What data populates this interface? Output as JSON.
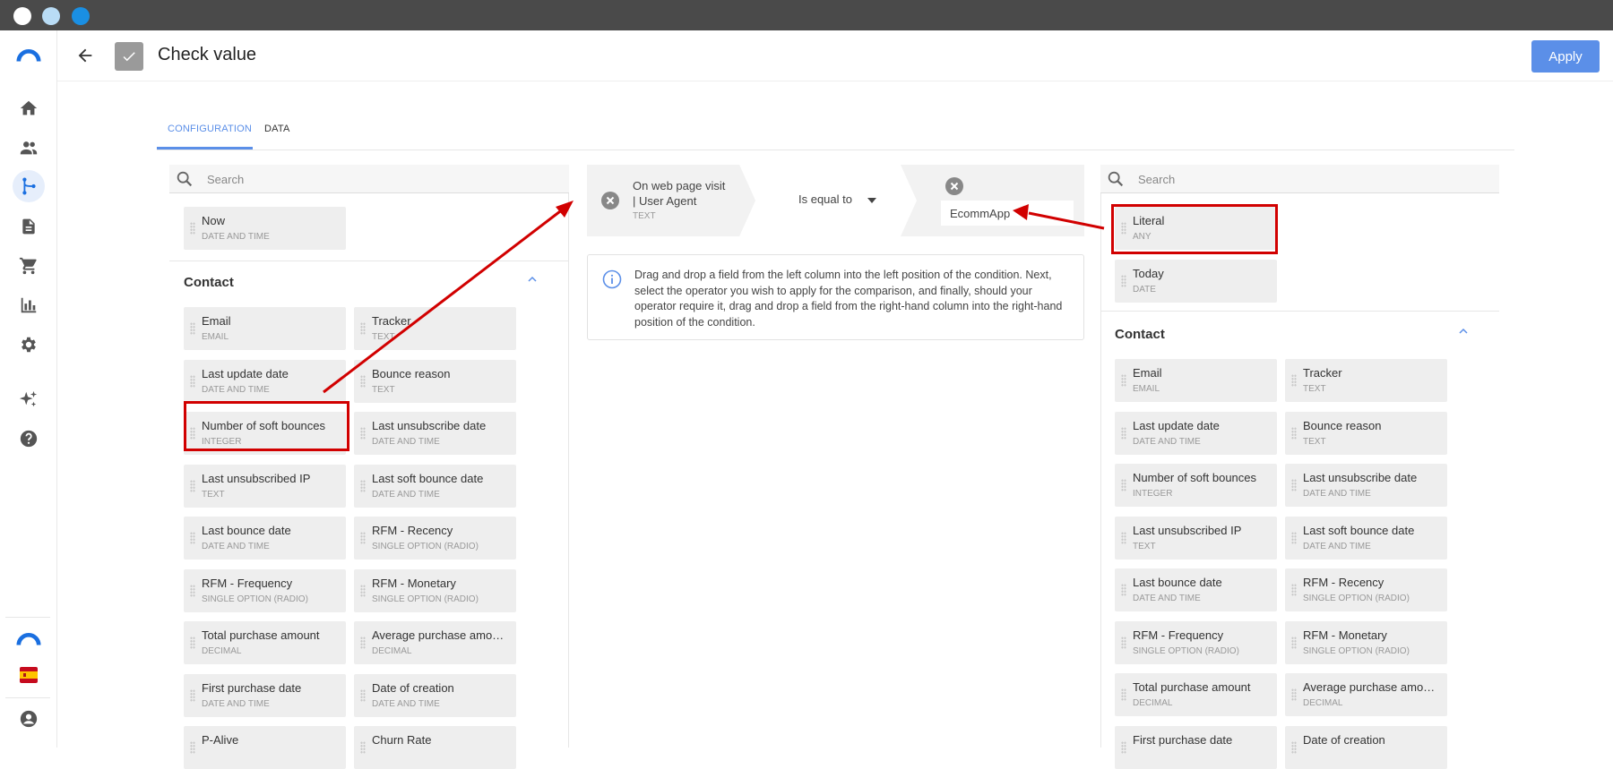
{
  "window": {
    "dots": [
      "#ffffff",
      "#b9dcf5",
      "#1a8fe3"
    ]
  },
  "header": {
    "title": "Check value",
    "apply_label": "Apply"
  },
  "colors": {
    "accent": "#5b8fe8",
    "highlight": "#d10000"
  },
  "sidebar": {
    "icons": [
      "home-icon",
      "contacts-icon",
      "workflow-icon",
      "document-icon",
      "cart-icon",
      "chart-icon",
      "gear-icon",
      "sparkle-icon",
      "help-icon"
    ]
  },
  "tabs": [
    {
      "label": "CONFIGURATION",
      "active": true
    },
    {
      "label": "DATA",
      "active": false
    }
  ],
  "left": {
    "search_placeholder": "Search",
    "top_items": [
      {
        "name": "Now",
        "type": "DATE AND TIME"
      }
    ],
    "section_title": "Contact",
    "items": [
      {
        "name": "Email",
        "type": "EMAIL"
      },
      {
        "name": "Tracker",
        "type": "TEXT"
      },
      {
        "name": "Last update date",
        "type": "DATE AND TIME"
      },
      {
        "name": "Bounce reason",
        "type": "TEXT"
      },
      {
        "name": "Number of soft bounces",
        "type": "INTEGER"
      },
      {
        "name": "Last unsubscribe date",
        "type": "DATE AND TIME"
      },
      {
        "name": "Last unsubscribed IP",
        "type": "TEXT"
      },
      {
        "name": "Last soft bounce date",
        "type": "DATE AND TIME"
      },
      {
        "name": "Last bounce date",
        "type": "DATE AND TIME"
      },
      {
        "name": "RFM - Recency",
        "type": "SINGLE OPTION (RADIO)"
      },
      {
        "name": "RFM - Frequency",
        "type": "SINGLE OPTION (RADIO)"
      },
      {
        "name": "RFM - Monetary",
        "type": "SINGLE OPTION (RADIO)"
      },
      {
        "name": "Total purchase amount",
        "type": "DECIMAL"
      },
      {
        "name": "Average purchase amo…",
        "type": "DECIMAL"
      },
      {
        "name": "First purchase date",
        "type": "DATE AND TIME"
      },
      {
        "name": "Date of creation",
        "type": "DATE AND TIME"
      },
      {
        "name": "P-Alive",
        "type": ""
      },
      {
        "name": "Churn Rate",
        "type": ""
      }
    ]
  },
  "condition": {
    "left_field_line1": "On web page visit",
    "left_field_line2": "| User Agent",
    "left_field_type": "TEXT",
    "operator": "Is equal to",
    "right_value": "EcommApp"
  },
  "info_text": "Drag and drop a field from the left column into the left position of the condition. Next, select the operator you wish to apply for the comparison, and finally, should your operator require it, drag and drop a field from the right-hand column into the right-hand position of the condition.",
  "right": {
    "search_placeholder": "Search",
    "top_items": [
      {
        "name": "Literal",
        "type": "ANY"
      },
      {
        "name": "Today",
        "type": "DATE"
      }
    ],
    "section_title": "Contact",
    "items": [
      {
        "name": "Email",
        "type": "EMAIL"
      },
      {
        "name": "Tracker",
        "type": "TEXT"
      },
      {
        "name": "Last update date",
        "type": "DATE AND TIME"
      },
      {
        "name": "Bounce reason",
        "type": "TEXT"
      },
      {
        "name": "Number of soft bounces",
        "type": "INTEGER"
      },
      {
        "name": "Last unsubscribe date",
        "type": "DATE AND TIME"
      },
      {
        "name": "Last unsubscribed IP",
        "type": "TEXT"
      },
      {
        "name": "Last soft bounce date",
        "type": "DATE AND TIME"
      },
      {
        "name": "Last bounce date",
        "type": "DATE AND TIME"
      },
      {
        "name": "RFM - Recency",
        "type": "SINGLE OPTION (RADIO)"
      },
      {
        "name": "RFM - Frequency",
        "type": "SINGLE OPTION (RADIO)"
      },
      {
        "name": "RFM - Monetary",
        "type": "SINGLE OPTION (RADIO)"
      },
      {
        "name": "Total purchase amount",
        "type": "DECIMAL"
      },
      {
        "name": "Average purchase amo…",
        "type": "DECIMAL"
      },
      {
        "name": "First purchase date",
        "type": ""
      },
      {
        "name": "Date of creation",
        "type": ""
      }
    ]
  }
}
